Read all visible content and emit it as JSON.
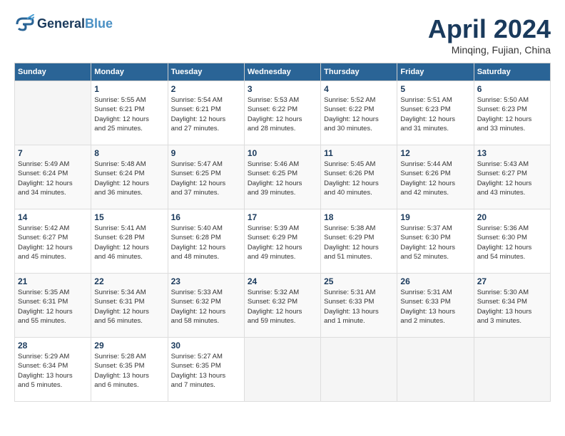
{
  "logo": {
    "line1": "General",
    "line2": "Blue"
  },
  "title": "April 2024",
  "subtitle": "Minqing, Fujian, China",
  "weekdays": [
    "Sunday",
    "Monday",
    "Tuesday",
    "Wednesday",
    "Thursday",
    "Friday",
    "Saturday"
  ],
  "weeks": [
    [
      {
        "num": "",
        "info": ""
      },
      {
        "num": "1",
        "info": "Sunrise: 5:55 AM\nSunset: 6:21 PM\nDaylight: 12 hours\nand 25 minutes."
      },
      {
        "num": "2",
        "info": "Sunrise: 5:54 AM\nSunset: 6:21 PM\nDaylight: 12 hours\nand 27 minutes."
      },
      {
        "num": "3",
        "info": "Sunrise: 5:53 AM\nSunset: 6:22 PM\nDaylight: 12 hours\nand 28 minutes."
      },
      {
        "num": "4",
        "info": "Sunrise: 5:52 AM\nSunset: 6:22 PM\nDaylight: 12 hours\nand 30 minutes."
      },
      {
        "num": "5",
        "info": "Sunrise: 5:51 AM\nSunset: 6:23 PM\nDaylight: 12 hours\nand 31 minutes."
      },
      {
        "num": "6",
        "info": "Sunrise: 5:50 AM\nSunset: 6:23 PM\nDaylight: 12 hours\nand 33 minutes."
      }
    ],
    [
      {
        "num": "7",
        "info": "Sunrise: 5:49 AM\nSunset: 6:24 PM\nDaylight: 12 hours\nand 34 minutes."
      },
      {
        "num": "8",
        "info": "Sunrise: 5:48 AM\nSunset: 6:24 PM\nDaylight: 12 hours\nand 36 minutes."
      },
      {
        "num": "9",
        "info": "Sunrise: 5:47 AM\nSunset: 6:25 PM\nDaylight: 12 hours\nand 37 minutes."
      },
      {
        "num": "10",
        "info": "Sunrise: 5:46 AM\nSunset: 6:25 PM\nDaylight: 12 hours\nand 39 minutes."
      },
      {
        "num": "11",
        "info": "Sunrise: 5:45 AM\nSunset: 6:26 PM\nDaylight: 12 hours\nand 40 minutes."
      },
      {
        "num": "12",
        "info": "Sunrise: 5:44 AM\nSunset: 6:26 PM\nDaylight: 12 hours\nand 42 minutes."
      },
      {
        "num": "13",
        "info": "Sunrise: 5:43 AM\nSunset: 6:27 PM\nDaylight: 12 hours\nand 43 minutes."
      }
    ],
    [
      {
        "num": "14",
        "info": "Sunrise: 5:42 AM\nSunset: 6:27 PM\nDaylight: 12 hours\nand 45 minutes."
      },
      {
        "num": "15",
        "info": "Sunrise: 5:41 AM\nSunset: 6:28 PM\nDaylight: 12 hours\nand 46 minutes."
      },
      {
        "num": "16",
        "info": "Sunrise: 5:40 AM\nSunset: 6:28 PM\nDaylight: 12 hours\nand 48 minutes."
      },
      {
        "num": "17",
        "info": "Sunrise: 5:39 AM\nSunset: 6:29 PM\nDaylight: 12 hours\nand 49 minutes."
      },
      {
        "num": "18",
        "info": "Sunrise: 5:38 AM\nSunset: 6:29 PM\nDaylight: 12 hours\nand 51 minutes."
      },
      {
        "num": "19",
        "info": "Sunrise: 5:37 AM\nSunset: 6:30 PM\nDaylight: 12 hours\nand 52 minutes."
      },
      {
        "num": "20",
        "info": "Sunrise: 5:36 AM\nSunset: 6:30 PM\nDaylight: 12 hours\nand 54 minutes."
      }
    ],
    [
      {
        "num": "21",
        "info": "Sunrise: 5:35 AM\nSunset: 6:31 PM\nDaylight: 12 hours\nand 55 minutes."
      },
      {
        "num": "22",
        "info": "Sunrise: 5:34 AM\nSunset: 6:31 PM\nDaylight: 12 hours\nand 56 minutes."
      },
      {
        "num": "23",
        "info": "Sunrise: 5:33 AM\nSunset: 6:32 PM\nDaylight: 12 hours\nand 58 minutes."
      },
      {
        "num": "24",
        "info": "Sunrise: 5:32 AM\nSunset: 6:32 PM\nDaylight: 12 hours\nand 59 minutes."
      },
      {
        "num": "25",
        "info": "Sunrise: 5:31 AM\nSunset: 6:33 PM\nDaylight: 13 hours\nand 1 minute."
      },
      {
        "num": "26",
        "info": "Sunrise: 5:31 AM\nSunset: 6:33 PM\nDaylight: 13 hours\nand 2 minutes."
      },
      {
        "num": "27",
        "info": "Sunrise: 5:30 AM\nSunset: 6:34 PM\nDaylight: 13 hours\nand 3 minutes."
      }
    ],
    [
      {
        "num": "28",
        "info": "Sunrise: 5:29 AM\nSunset: 6:34 PM\nDaylight: 13 hours\nand 5 minutes."
      },
      {
        "num": "29",
        "info": "Sunrise: 5:28 AM\nSunset: 6:35 PM\nDaylight: 13 hours\nand 6 minutes."
      },
      {
        "num": "30",
        "info": "Sunrise: 5:27 AM\nSunset: 6:35 PM\nDaylight: 13 hours\nand 7 minutes."
      },
      {
        "num": "",
        "info": ""
      },
      {
        "num": "",
        "info": ""
      },
      {
        "num": "",
        "info": ""
      },
      {
        "num": "",
        "info": ""
      }
    ]
  ]
}
